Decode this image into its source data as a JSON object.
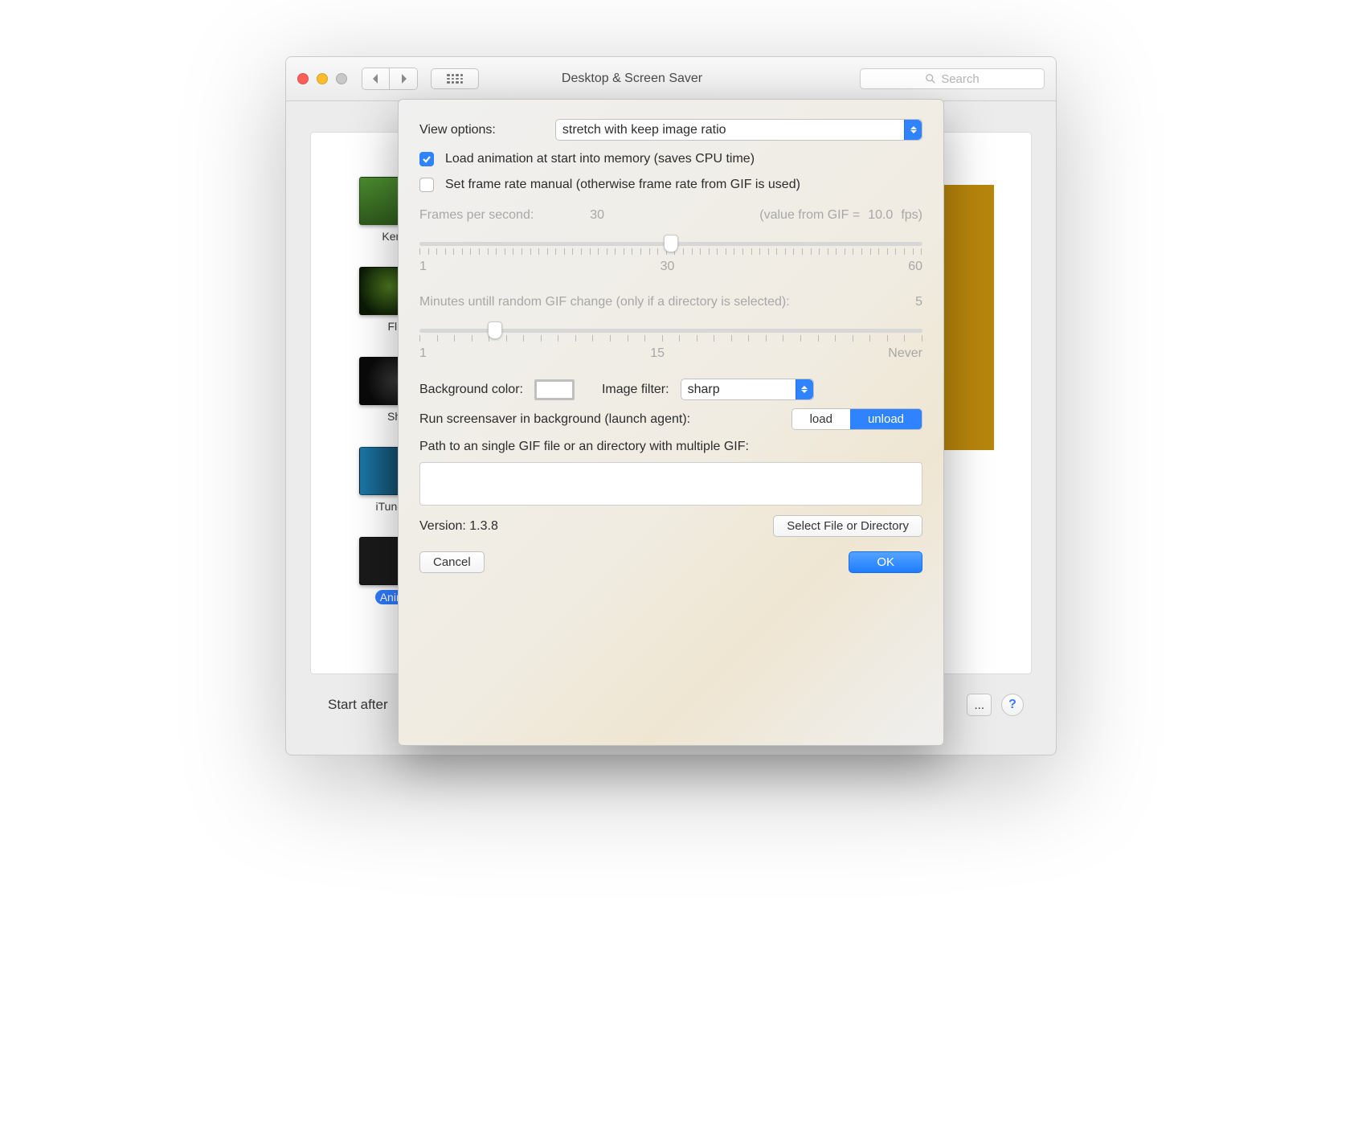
{
  "window": {
    "title": "Desktop & Screen Saver",
    "search_placeholder": "Search",
    "start_after_label": "Start after",
    "ellipsis_button": "...",
    "help_button": "?"
  },
  "sidebar": {
    "items": [
      {
        "name": "Ken B",
        "css": "background:linear-gradient(#4a8b2e,#2f5b1d);"
      },
      {
        "name": "Flur",
        "css": "background:radial-gradient(circle at 40% 40%, #4e7a1e 0, #0b1a06 60%);"
      },
      {
        "name": "She",
        "css": "background:radial-gradient(circle at 50% 50%, #3a3a3a 0, #0a0a0a 70%);"
      },
      {
        "name": "iTunes A",
        "css": "background:linear-gradient(90deg,#1b77a8,#0e2430);"
      },
      {
        "name": "Animat",
        "css": "background:#1a1a1a;",
        "selected": true
      }
    ]
  },
  "sheet": {
    "view_options_label": "View options:",
    "view_options_value": "stretch with keep image ratio",
    "chk_load_label": "Load animation at start into memory (saves CPU time)",
    "chk_load_checked": true,
    "chk_manual_label": "Set frame rate manual (otherwise frame rate from GIF is used)",
    "chk_manual_checked": false,
    "fps_label": "Frames per second:",
    "fps_input_value": "30",
    "fps_from_gif_prefix": "(value from GIF =",
    "fps_from_gif_value": "10.0",
    "fps_unit": "fps)",
    "fps_slider": {
      "min": "1",
      "mid": "30",
      "max": "60",
      "pos_percent": 50
    },
    "minutes_label": "Minutes untill random GIF change (only if a directory is selected):",
    "minutes_value": "5",
    "minutes_slider": {
      "min": "1",
      "mid": "15",
      "max": "Never",
      "pos_percent": 15
    },
    "bg_color_label": "Background color:",
    "img_filter_label": "Image filter:",
    "img_filter_value": "sharp",
    "run_bg_label": "Run screensaver in background (launch agent):",
    "seg_load": "load",
    "seg_unload": "unload",
    "seg_active": "unload",
    "path_label": "Path to an single GIF file or an directory with multiple GIF:",
    "path_value": "",
    "version_label": "Version:",
    "version_value": "1.3.8",
    "select_btn": "Select File or Directory",
    "cancel_btn": "Cancel",
    "ok_btn": "OK"
  }
}
